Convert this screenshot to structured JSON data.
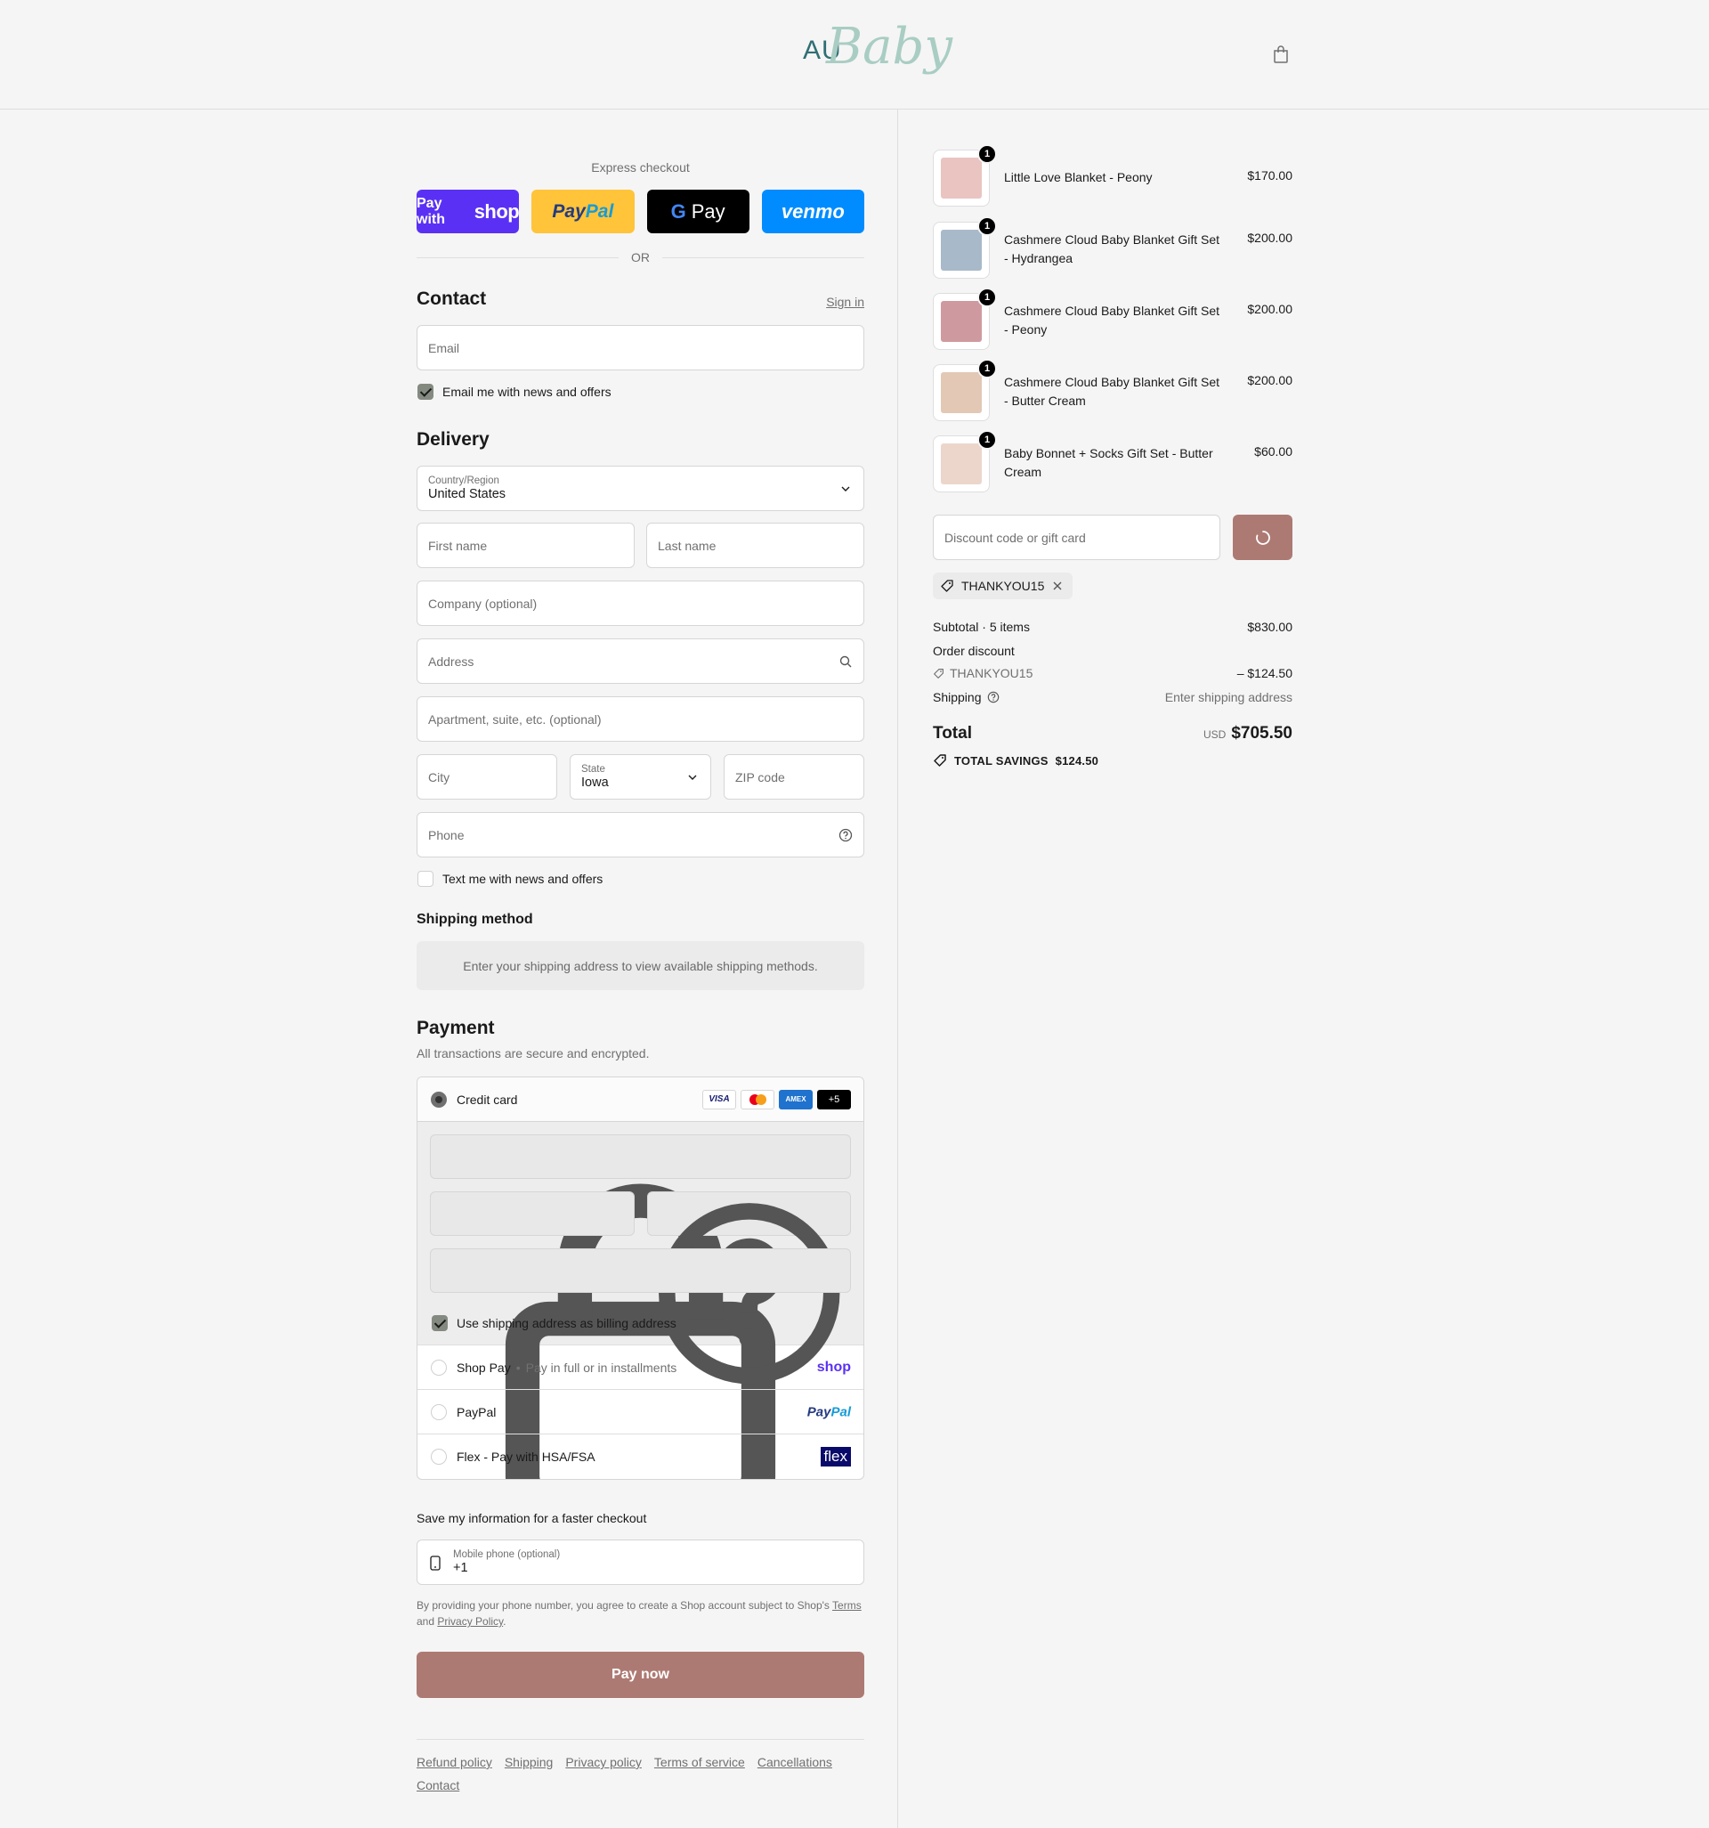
{
  "brand": {
    "logo_au": "AU",
    "logo_baby": "Baby"
  },
  "express": {
    "label": "Express checkout",
    "shop_pre": "Pay with",
    "shop_brand": "shop",
    "paypal_a": "Pay",
    "paypal_b": "Pal",
    "gpay_g": "G",
    "gpay_text": "Pay",
    "venmo": "venmo",
    "or": "OR"
  },
  "contact": {
    "title": "Contact",
    "sign_in": "Sign in",
    "email_placeholder": "Email",
    "news_label": "Email me with news and offers",
    "news_checked": true
  },
  "delivery": {
    "title": "Delivery",
    "country_label": "Country/Region",
    "country_value": "United States",
    "first_name": "First name",
    "last_name": "Last name",
    "company": "Company (optional)",
    "address": "Address",
    "apartment": "Apartment, suite, etc. (optional)",
    "city": "City",
    "state_label": "State",
    "state_value": "Iowa",
    "zip": "ZIP code",
    "phone": "Phone",
    "text_label": "Text me with news and offers",
    "text_checked": false
  },
  "shipping_method": {
    "title": "Shipping method",
    "message": "Enter your shipping address to view available shipping methods."
  },
  "payment": {
    "title": "Payment",
    "subtitle": "All transactions are secure and encrypted.",
    "credit_card": "Credit card",
    "card_brands": [
      "VISA",
      "MC",
      "AMEX",
      "+5"
    ],
    "billing_label": "Use shipping address as billing address",
    "shop_pay": "Shop Pay",
    "shop_pay_sub": "Pay in full or in installments",
    "shop_brand": "shop",
    "paypal": "PayPal",
    "paypal_brand_a": "Pay",
    "paypal_brand_b": "Pal",
    "flex": "Flex - Pay with HSA/FSA",
    "flex_brand": "flex"
  },
  "save_info": {
    "title": "Save my information for a faster checkout",
    "mobile_label": "Mobile phone (optional)",
    "mobile_value": "+1",
    "legal_1": "By providing your phone number, you agree to create a Shop account subject to Shop's",
    "terms": "Terms",
    "and": "and",
    "privacy": "Privacy Policy",
    "period": "."
  },
  "pay_now": "Pay now",
  "footer_links": [
    "Refund policy",
    "Shipping",
    "Privacy policy",
    "Terms of service",
    "Cancellations",
    "Contact"
  ],
  "cart": {
    "items": [
      {
        "name": "Little Love Blanket - Peony",
        "price": "$170.00",
        "qty": "1",
        "color": "#e9c4c1"
      },
      {
        "name": "Cashmere Cloud Baby Blanket Gift Set - Hydrangea",
        "price": "$200.00",
        "qty": "1",
        "color": "#a8b9c9"
      },
      {
        "name": "Cashmere Cloud Baby Blanket Gift Set - Peony",
        "price": "$200.00",
        "qty": "1",
        "color": "#cf9a9f"
      },
      {
        "name": "Cashmere Cloud Baby Blanket Gift Set - Butter Cream",
        "price": "$200.00",
        "qty": "1",
        "color": "#e2c8b5"
      },
      {
        "name": "Baby Bonnet + Socks Gift Set - Butter Cream",
        "price": "$60.00",
        "qty": "1",
        "color": "#ecd6cb"
      }
    ],
    "discount_placeholder": "Discount code or gift card",
    "applied_code": "THANKYOU15",
    "subtotal_label": "Subtotal · 5 items",
    "subtotal": "$830.00",
    "order_discount_label": "Order discount",
    "discount_code": "THANKYOU15",
    "discount_amount": "– $124.50",
    "shipping_label": "Shipping",
    "shipping_value": "Enter shipping address",
    "total_label": "Total",
    "currency": "USD",
    "total": "$705.50",
    "savings_label": "TOTAL SAVINGS",
    "savings": "$124.50"
  },
  "colors": {
    "accent": "#ad7a73",
    "shop": "#5a31f4",
    "paypal": "#ffc439",
    "venmo": "#008cff"
  }
}
